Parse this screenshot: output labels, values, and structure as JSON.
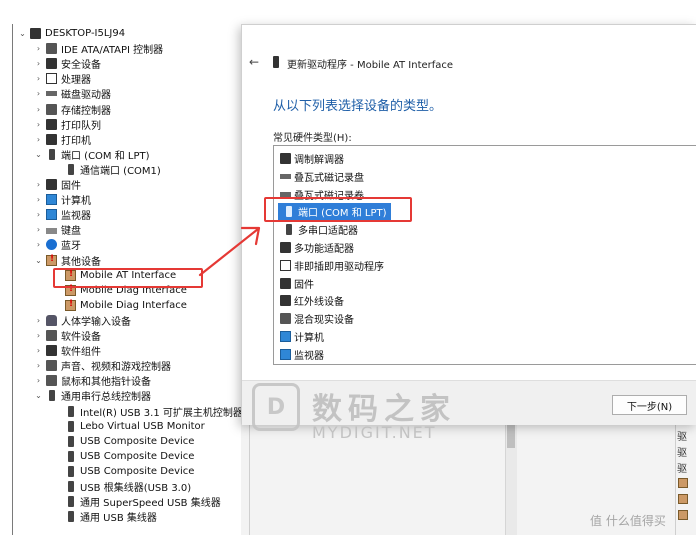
{
  "tree": {
    "root": "DESKTOP-I5LJ94",
    "items": [
      {
        "label": "IDE ATA/ATAPI 控制器",
        "icon": "ide-controller-icon",
        "expanded": false
      },
      {
        "label": "安全设备",
        "icon": "security-device-icon",
        "expanded": false
      },
      {
        "label": "处理器",
        "icon": "processor-icon",
        "expanded": false
      },
      {
        "label": "磁盘驱动器",
        "icon": "disk-drive-icon",
        "expanded": false
      },
      {
        "label": "存储控制器",
        "icon": "storage-controller-icon",
        "expanded": false
      },
      {
        "label": "打印队列",
        "icon": "print-queue-icon",
        "expanded": false
      },
      {
        "label": "打印机",
        "icon": "printer-icon",
        "expanded": false
      },
      {
        "label": "端口 (COM 和 LPT)",
        "icon": "port-icon",
        "expanded": true
      },
      {
        "label": "通信端口 (COM1)",
        "icon": "port-icon",
        "child": true
      },
      {
        "label": "固件",
        "icon": "firmware-icon",
        "expanded": false
      },
      {
        "label": "计算机",
        "icon": "computer-icon",
        "expanded": false
      },
      {
        "label": "监视器",
        "icon": "monitor-icon",
        "expanded": false
      },
      {
        "label": "键盘",
        "icon": "keyboard-icon",
        "expanded": false
      },
      {
        "label": "蓝牙",
        "icon": "bluetooth-icon",
        "expanded": false
      },
      {
        "label": "其他设备",
        "icon": "unknown-device-icon",
        "expanded": true
      },
      {
        "label": "Mobile AT Interface",
        "icon": "warning-device-icon",
        "child": true
      },
      {
        "label": "Mobile Diag Interface",
        "icon": "warning-device-icon",
        "child": true
      },
      {
        "label": "Mobile Diag Interface",
        "icon": "warning-device-icon",
        "child": true
      },
      {
        "label": "人体学输入设备",
        "icon": "hid-icon",
        "expanded": false
      },
      {
        "label": "软件设备",
        "icon": "software-device-icon",
        "expanded": false
      },
      {
        "label": "软件组件",
        "icon": "software-component-icon",
        "expanded": false
      },
      {
        "label": "声音、视频和游戏控制器",
        "icon": "sound-icon",
        "expanded": false
      },
      {
        "label": "鼠标和其他指针设备",
        "icon": "mouse-icon",
        "expanded": false
      },
      {
        "label": "通用串行总线控制器",
        "icon": "usb-icon",
        "expanded": true
      },
      {
        "label": "Intel(R) USB 3.1 可扩展主机控制器 - 1.10 (Microsoft)",
        "icon": "usb-icon",
        "child": true
      },
      {
        "label": "Lebo Virtual USB Monitor",
        "icon": "usb-icon",
        "child": true
      },
      {
        "label": "USB Composite Device",
        "icon": "usb-icon",
        "child": true
      },
      {
        "label": "USB Composite Device",
        "icon": "usb-icon",
        "child": true
      },
      {
        "label": "USB Composite Device",
        "icon": "usb-icon",
        "child": true
      },
      {
        "label": "USB 根集线器(USB 3.0)",
        "icon": "usb-icon",
        "child": true
      },
      {
        "label": "通用 SuperSpeed USB 集线器",
        "icon": "usb-icon",
        "child": true
      },
      {
        "label": "通用 USB 集线器",
        "icon": "usb-icon",
        "child": true
      }
    ]
  },
  "dialog": {
    "back_glyph": "←",
    "title": "更新驱动程序 - Mobile AT Interface",
    "heading": "从以下列表选择设备的类型。",
    "list_label": "常见硬件类型(H):",
    "hardware_types": [
      {
        "label": "调制解调器",
        "icon": "modem-icon"
      },
      {
        "label": "叠瓦式磁记录盘",
        "icon": "disk-icon"
      },
      {
        "label": "叠瓦式磁记录卷",
        "icon": "disk-icon"
      },
      {
        "label": "端口 (COM 和 LPT)",
        "icon": "port-icon",
        "selected": true
      },
      {
        "label": "多串口适配器",
        "icon": "multiport-icon"
      },
      {
        "label": "多功能适配器",
        "icon": "multifunction-icon"
      },
      {
        "label": "非即插即用驱动程序",
        "icon": "non-pnp-icon"
      },
      {
        "label": "固件",
        "icon": "firmware-icon"
      },
      {
        "label": "红外线设备",
        "icon": "infrared-icon"
      },
      {
        "label": "混合现实设备",
        "icon": "mixed-reality-icon"
      },
      {
        "label": "计算机",
        "icon": "computer-icon"
      },
      {
        "label": "监视器",
        "icon": "monitor-icon"
      }
    ],
    "next_button": "下一步(N)"
  },
  "underlying_window": {
    "tab_glyphs": [
      "驱",
      "驱",
      "驱"
    ]
  },
  "watermarks": {
    "logo_glyph": "D",
    "site_cn": "数码之家",
    "site_en": "MYDIGIT.NET",
    "zdm": "值 什么值得买"
  },
  "colors": {
    "accent": "#2f7ed8",
    "heading": "#1f5fa8",
    "annotation": "#e53935"
  }
}
